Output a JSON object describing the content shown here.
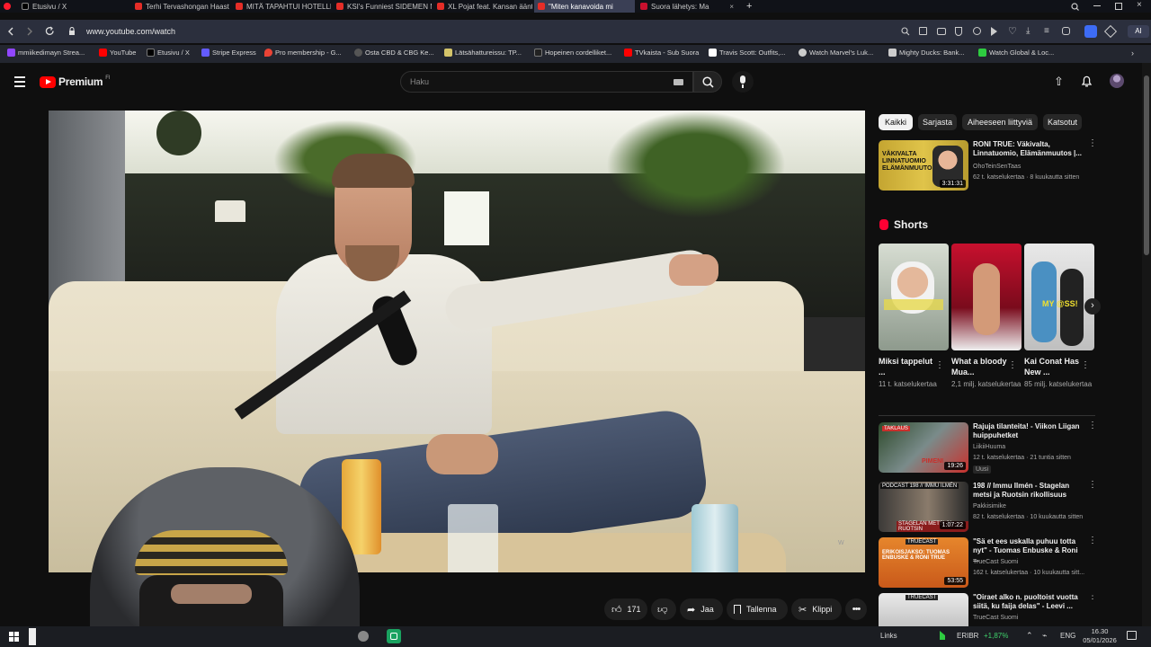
{
  "browser": {
    "tabs": [
      {
        "label": "Etusivu / X",
        "active": false
      },
      {
        "label": "Terhi Tervashongan Haast",
        "active": false
      },
      {
        "label": "MITÄ TAPAHTUI HOTELLIL",
        "active": false
      },
      {
        "label": "KSI's Funniest SIDEMEN M",
        "active": false
      },
      {
        "label": "XL Pojat feat. Kansan äänt",
        "active": false
      },
      {
        "label": "\"Miten kanavoida mi",
        "active": true
      },
      {
        "label": "Suora lähetys: Ma",
        "active": false
      }
    ],
    "url": "www.youtube.com/watch",
    "bookmarks": [
      {
        "label": "mmiikedimayn Strea...",
        "color": "#9146ff"
      },
      {
        "label": "YouTube",
        "color": "#ff0000"
      },
      {
        "label": "Etusivu / X",
        "color": "#000000"
      },
      {
        "label": "Stripe Express",
        "color": "#635bff"
      },
      {
        "label": "Pro membership - G...",
        "color": "#ea4335"
      },
      {
        "label": "Osta CBD & CBG Ke...",
        "color": "#888888"
      },
      {
        "label": "Lätsähattureissu: TP...",
        "color": "#d4c46a"
      },
      {
        "label": "Hopeinen cordelliket...",
        "color": "#222222"
      },
      {
        "label": "TVkaista - Sub Suora",
        "color": "#ff0000"
      },
      {
        "label": "Travis Scott: Outfits,...",
        "color": "#ffffff"
      },
      {
        "label": "Watch Marvel's Luk...",
        "color": "#cccccc"
      },
      {
        "label": "Mighty Ducks: Bank...",
        "color": "#cccccc"
      },
      {
        "label": "Watch Global & Loc...",
        "color": "#2ecc40"
      }
    ]
  },
  "youtube": {
    "logo_text": "Premium",
    "logo_sup": "FI",
    "search_placeholder": "Haku",
    "chips": [
      {
        "label": "Kaikki",
        "active": true
      },
      {
        "label": "Sarjasta",
        "active": false
      },
      {
        "label": "Aiheeseen liittyviä",
        "active": false
      },
      {
        "label": "Katsotut",
        "active": false
      }
    ],
    "top_video": {
      "title": "RONI TRUE: Väkivalta, Linnatuomio, Elämänmuutos |...",
      "channel": "OhoTeinSenTaas",
      "meta": "62 t. katselukertaa · 8 kuukautta sitten",
      "duration": "3:31:31",
      "thumb_text": "VÄKIVALTA LINNATUOMIO ELÄMÄNMUUTOS"
    },
    "shorts_heading": "Shorts",
    "shorts": [
      {
        "title": "Miksi tappelut ...",
        "views": "11 t. katselukertaa"
      },
      {
        "title": "What a bloody Mua...",
        "views": "2,1 milj. katselukertaa"
      },
      {
        "title": "Kai Conat Has New ...",
        "views": "85 milj. katselukertaa"
      }
    ],
    "related": [
      {
        "title": "Rajuja tilanteita! - Viikon Liigan huippuhetket",
        "channel": "LiikiiHuuma",
        "meta": "12 t. katselukertaa · 21 tuntia sitten",
        "badge": "Uusi",
        "duration": "19:26"
      },
      {
        "title": "198 // Immu Ilmén - Stagelan metsi ja Ruotsin rikollisuus",
        "channel": "Pakkisimike",
        "meta": "82 t. katselukertaa · 10 kuukautta sitten",
        "badge": "",
        "duration": "1:07:22"
      },
      {
        "title": "\"Sä et ees uskalla puhuu totta nyt\" - Tuomas Enbuske & Roni ...",
        "channel": "TrueCast Suomi",
        "meta": "162 t. katselukertaa · 10 kuukautta sitt...",
        "badge": "",
        "duration": "53:55"
      },
      {
        "title": "\"Oiraet alko n. puoltoist vuotta siitä, ku faija delas\" - Leevi ...",
        "channel": "TrueCast Suomi",
        "meta": "",
        "badge": "",
        "duration": ""
      }
    ],
    "actions": {
      "likes": "171",
      "share": "Jaa",
      "save": "Tallenna",
      "clip": "Klippi"
    }
  },
  "taskbar": {
    "links": "Links",
    "ticker": "ERIBR",
    "ticker_change": "+1,87%",
    "lang": "ENG",
    "time": "16.30",
    "date": "05/01/2026"
  }
}
